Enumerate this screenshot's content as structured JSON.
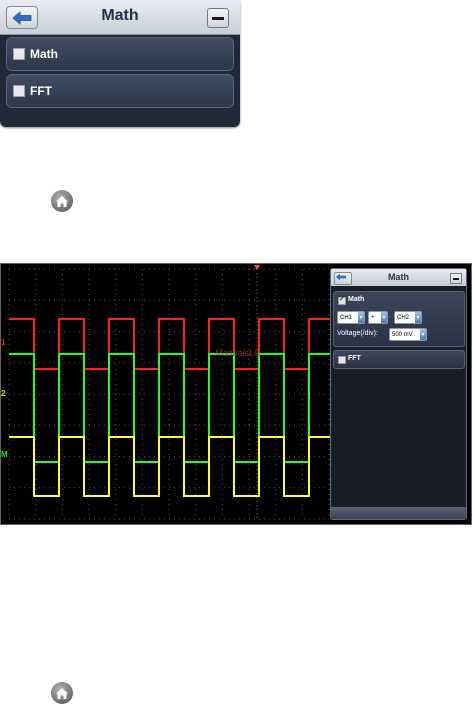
{
  "math_menu": {
    "title": "Math",
    "items": [
      {
        "label": "Math",
        "checked": false
      },
      {
        "label": "FFT",
        "checked": false
      }
    ]
  },
  "home_icon": "home-icon",
  "scope": {
    "watermark": "ManualsLib",
    "channel_markers": [
      {
        "label": "1",
        "color": "#e02020"
      },
      {
        "label": "2",
        "color": "#e0e020"
      },
      {
        "label": "M",
        "color": "#20e020"
      }
    ],
    "trace_colors": {
      "ch1": "#ff2020",
      "ch2": "#ffff20",
      "math": "#20ff20",
      "trigger": "#ff5050"
    },
    "panel": {
      "title": "Math",
      "math_label": "Math",
      "math_checked": true,
      "source1": "CH1",
      "operator": "+",
      "source2": "CH2",
      "voltage_label": "Voltage(/div):",
      "voltage_value": "500 mV",
      "fft_label": "FFT",
      "fft_checked": false
    }
  }
}
